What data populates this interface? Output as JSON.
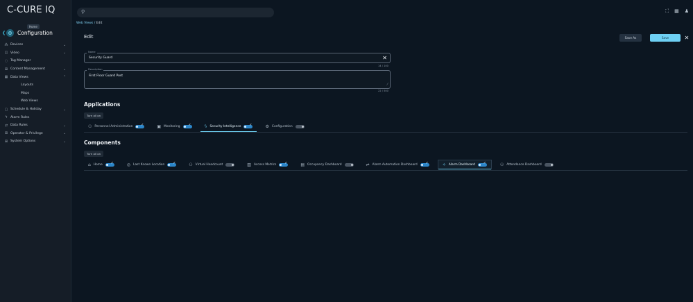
{
  "app": {
    "title": "C-CURE IQ"
  },
  "sidebar": {
    "home_tooltip": "Home",
    "section": "Configuration",
    "items": [
      {
        "label": "Devices",
        "icon": "devices-icon",
        "glyph": "⁂",
        "chevron": "⌄"
      },
      {
        "label": "Video",
        "icon": "video-icon",
        "glyph": "◫",
        "chevron": "⌄"
      },
      {
        "label": "Tag Manager",
        "icon": "tag-icon",
        "glyph": "◌",
        "chevron": ""
      },
      {
        "label": "Content Management",
        "icon": "content-icon",
        "glyph": "⊞",
        "chevron": "⌄"
      },
      {
        "label": "Data Views",
        "icon": "data-views-icon",
        "glyph": "▦",
        "chevron": "⌃"
      },
      {
        "label": "Layouts",
        "sub": true
      },
      {
        "label": "Maps",
        "sub": true
      },
      {
        "label": "Web Views",
        "sub": true
      },
      {
        "label": "Schedule & Holiday",
        "icon": "calendar-icon",
        "glyph": "▢",
        "chevron": "⌄"
      },
      {
        "label": "Alarm Rules",
        "icon": "alarm-rules-icon",
        "glyph": "ϟ",
        "chevron": ""
      },
      {
        "label": "Data Rules",
        "icon": "data-rules-icon",
        "glyph": "⇄",
        "chevron": "⌄"
      },
      {
        "label": "Operator & Privilege",
        "icon": "operator-icon",
        "glyph": "⊞",
        "chevron": "⌄"
      },
      {
        "label": "System Options",
        "icon": "system-options-icon",
        "glyph": "⊞",
        "chevron": "⌄"
      }
    ]
  },
  "breadcrumb": {
    "parent": "Web Views",
    "separator": " / ",
    "current": "Edit"
  },
  "header": {
    "title": "Edit",
    "save_as": "Save As",
    "save": "Save",
    "close": "✕"
  },
  "form": {
    "name_label": "Name",
    "name_value": "Security Guard",
    "name_counter": "14 / 100",
    "desc_label": "Description",
    "desc_value": "First Floor Guard Post",
    "desc_counter": "22 / 500"
  },
  "applications": {
    "title": "Applications",
    "turn_all_on": "Turn all on",
    "tabs": [
      {
        "label": "Personnel Administration",
        "icon": "people-icon",
        "glyph": "⚇",
        "toggle": "on",
        "active": false
      },
      {
        "label": "Monitoring",
        "icon": "monitor-icon",
        "glyph": "▣",
        "toggle": "on",
        "active": false
      },
      {
        "label": "Security Intelligence",
        "icon": "bolt-icon",
        "glyph": "ϟ",
        "toggle": "on",
        "active": true
      },
      {
        "label": "Configuration",
        "icon": "gear-icon",
        "glyph": "⚙",
        "toggle": "off",
        "active": false
      }
    ]
  },
  "components": {
    "title": "Components",
    "turn_all_on": "Turn all on",
    "tabs": [
      {
        "label": "Home",
        "icon": "home-icon",
        "glyph": "⌂",
        "toggle": "on",
        "active": false
      },
      {
        "label": "Last Known Location",
        "icon": "location-icon",
        "glyph": "◎",
        "toggle": "on",
        "active": false
      },
      {
        "label": "Virtual Headcount",
        "icon": "headcount-icon",
        "glyph": "⚇",
        "toggle": "off",
        "active": false
      },
      {
        "label": "Access Metrics",
        "icon": "metrics-icon",
        "glyph": "▥",
        "toggle": "on",
        "active": false
      },
      {
        "label": "Occupancy Dashboard",
        "icon": "occupancy-icon",
        "glyph": "▤",
        "toggle": "off",
        "active": false
      },
      {
        "label": "Alarm Automation Dashboard",
        "icon": "automation-icon",
        "glyph": "⇌",
        "toggle": "on",
        "active": false
      },
      {
        "label": "Alarm Dashboard",
        "icon": "alarm-icon",
        "glyph": "✧",
        "toggle": "on",
        "active": true
      },
      {
        "label": "Attendance Dashboard",
        "icon": "attendance-icon",
        "glyph": "⚇",
        "toggle": "off",
        "active": false
      }
    ]
  },
  "colors": {
    "accent": "#6ed0f4",
    "background": "#0c1621",
    "sidebar": "#151d27"
  }
}
